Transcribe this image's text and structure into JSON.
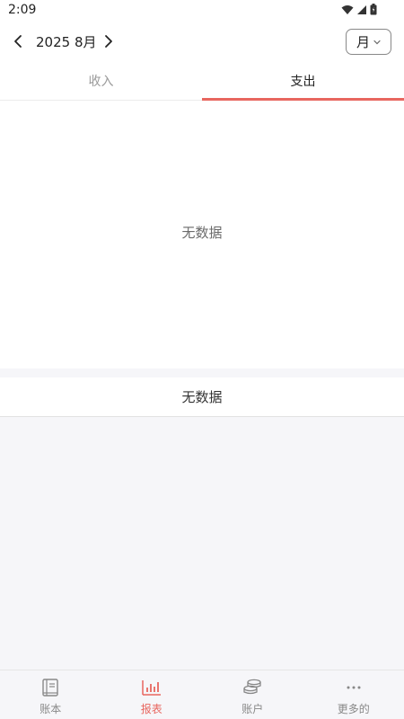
{
  "status_bar": {
    "time": "2:09"
  },
  "header": {
    "period": "2025 8月",
    "granularity": "月"
  },
  "tabs": [
    {
      "label": "收入",
      "active": false
    },
    {
      "label": "支出",
      "active": true
    }
  ],
  "chart": {
    "empty_text": "无数据"
  },
  "list": {
    "empty_text": "无数据"
  },
  "bottom_nav": {
    "items": [
      {
        "label": "账本",
        "icon": "book-icon",
        "active": false
      },
      {
        "label": "报表",
        "icon": "bar-chart-icon",
        "active": true
      },
      {
        "label": "账户",
        "icon": "coins-icon",
        "active": false
      },
      {
        "label": "更多的",
        "icon": "more-dots-icon",
        "active": false
      }
    ]
  },
  "colors": {
    "accent": "#e8665f",
    "inactive": "#888888",
    "background": "#f6f6f9"
  }
}
